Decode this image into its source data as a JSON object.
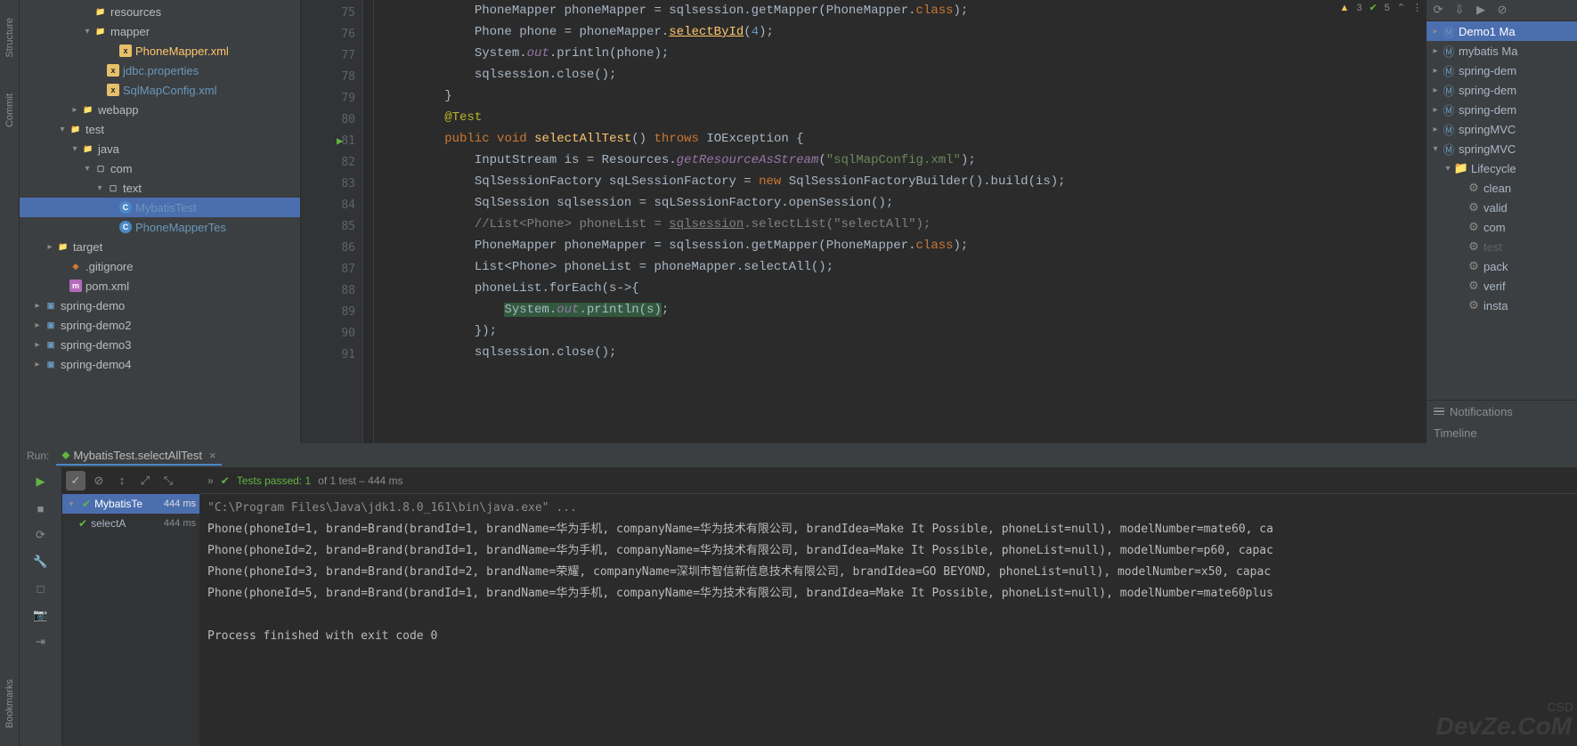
{
  "rail": {
    "structure": "Structure",
    "commit": "Commit",
    "bookmarks": "Bookmarks"
  },
  "tree": {
    "items": [
      {
        "indent": 5,
        "chev": "",
        "icon": "dir",
        "label": "resources",
        "cls": ""
      },
      {
        "indent": 5,
        "chev": "▾",
        "icon": "dir",
        "label": "mapper",
        "cls": ""
      },
      {
        "indent": 7,
        "chev": "",
        "icon": "xml",
        "label": "PhoneMapper.xml",
        "cls": "active-file"
      },
      {
        "indent": 6,
        "chev": "",
        "icon": "xml",
        "label": "jdbc.properties",
        "cls": "xml-link"
      },
      {
        "indent": 6,
        "chev": "",
        "icon": "xml",
        "label": "SqlMapConfig.xml",
        "cls": "xml-link"
      },
      {
        "indent": 4,
        "chev": "▸",
        "icon": "dir",
        "label": "webapp",
        "cls": ""
      },
      {
        "indent": 3,
        "chev": "▾",
        "icon": "test-dir",
        "label": "test",
        "cls": ""
      },
      {
        "indent": 4,
        "chev": "▾",
        "icon": "test-src",
        "label": "java",
        "cls": ""
      },
      {
        "indent": 5,
        "chev": "▾",
        "icon": "pkg",
        "label": "com",
        "cls": ""
      },
      {
        "indent": 6,
        "chev": "▾",
        "icon": "pkg",
        "label": "text",
        "cls": ""
      },
      {
        "indent": 7,
        "chev": "",
        "icon": "class",
        "label": "MybatisTest",
        "cls": "xml-link",
        "sel": true
      },
      {
        "indent": 7,
        "chev": "",
        "icon": "class",
        "label": "PhoneMapperTes",
        "cls": "xml-link"
      },
      {
        "indent": 2,
        "chev": "▸",
        "icon": "target",
        "label": "target",
        "cls": ""
      },
      {
        "indent": 3,
        "chev": "",
        "icon": "git",
        "label": ".gitignore",
        "cls": ""
      },
      {
        "indent": 3,
        "chev": "",
        "icon": "pom",
        "label": "pom.xml",
        "cls": ""
      },
      {
        "indent": 1,
        "chev": "▸",
        "icon": "mod",
        "label": "spring-demo",
        "cls": ""
      },
      {
        "indent": 1,
        "chev": "▸",
        "icon": "mod",
        "label": "spring-demo2",
        "cls": ""
      },
      {
        "indent": 1,
        "chev": "▸",
        "icon": "mod",
        "label": "spring-demo3",
        "cls": ""
      },
      {
        "indent": 1,
        "chev": "▸",
        "icon": "mod",
        "label": "spring-demo4",
        "cls": ""
      }
    ]
  },
  "editor": {
    "status_warn": "3",
    "status_ok": "5",
    "lines": [
      {
        "n": 75,
        "html": "            <span class='cls'>PhoneMapper phoneMapper = sqlsession.getMapper(PhoneMapper.</span><span class='kw'>class</span><span class='cls'>);</span>"
      },
      {
        "n": 76,
        "html": "            <span class='cls'>Phone phone = phoneMapper.</span><span class='mth und'>selectById</span><span class='cls'>(</span><span class='num'>4</span><span class='cls'>);</span>"
      },
      {
        "n": 77,
        "html": "            <span class='cls'>System.</span><span class='fld'>out</span><span class='cls'>.println(phone);</span>"
      },
      {
        "n": 78,
        "html": "            <span class='cls'>sqlsession.close();</span>"
      },
      {
        "n": 79,
        "html": "        <span class='cls'>}</span>"
      },
      {
        "n": 80,
        "html": "        <span class='ann'>@Test</span>"
      },
      {
        "n": 81,
        "html": "        <span class='kw'>public</span> <span class='kw'>void</span> <span class='mth'>selectAllTest</span><span class='cls'>()</span> <span class='kw'>throws</span> <span class='cls'>IOException {</span>",
        "run": true
      },
      {
        "n": 82,
        "html": "            <span class='cls'>InputStream is = Resources.</span><span class='fld'>getResourceAsStream</span><span class='cls'>(</span><span class='str'>\"sqlMapConfig.xml\"</span><span class='cls'>);</span>"
      },
      {
        "n": 83,
        "html": "            <span class='cls'>SqlSessionFactory sqLSessionFactory = </span><span class='kw'>new</span> <span class='cls'>SqlSessionFactoryBuilder().build(is);</span>"
      },
      {
        "n": 84,
        "html": "            <span class='cls'>SqlSession sqlsession = sqLSessionFactory.openSession();</span>"
      },
      {
        "n": 85,
        "html": "            <span class='cmt'>//List&lt;Phone&gt; phoneList = </span><span class='cmt und'>sqlsession</span><span class='cmt'>.selectList(\"selectAll\");</span>"
      },
      {
        "n": 86,
        "html": "            <span class='cls'>PhoneMapper phoneMapper = sqlsession.getMapper(PhoneMapper.</span><span class='kw'>class</span><span class='cls'>);</span>"
      },
      {
        "n": 87,
        "html": "            <span class='cls'>List&lt;Phone&gt; phoneList = phoneMapper.selectAll();</span>"
      },
      {
        "n": 88,
        "html": "            <span class='cls'>phoneList.forEach(s-&gt;{</span>"
      },
      {
        "n": 89,
        "html": "                <span class='hl'><span class='cls'>System.</span><span class='fld'>out</span><span class='cls'>.println(s)</span></span><span class='cls'>;</span>"
      },
      {
        "n": 90,
        "html": "            <span class='cls'>});</span>"
      },
      {
        "n": 91,
        "html": "            <span class='cls'>sqlsession.close();</span>"
      }
    ]
  },
  "maven": {
    "items": [
      {
        "indent": 0,
        "chev": "▸",
        "icon": "mod",
        "label": "Demo1 Ma",
        "sel": true
      },
      {
        "indent": 0,
        "chev": "▸",
        "icon": "mod",
        "label": "mybatis Ma"
      },
      {
        "indent": 0,
        "chev": "▸",
        "icon": "mod",
        "label": "spring-dem"
      },
      {
        "indent": 0,
        "chev": "▸",
        "icon": "mod",
        "label": "spring-dem"
      },
      {
        "indent": 0,
        "chev": "▸",
        "icon": "mod",
        "label": "spring-dem"
      },
      {
        "indent": 0,
        "chev": "▸",
        "icon": "mod",
        "label": "springMVC"
      },
      {
        "indent": 0,
        "chev": "▾",
        "icon": "mod",
        "label": "springMVC"
      },
      {
        "indent": 1,
        "chev": "▾",
        "icon": "folder",
        "label": "Lifecycle"
      },
      {
        "indent": 2,
        "chev": "",
        "icon": "gear",
        "label": "clean"
      },
      {
        "indent": 2,
        "chev": "",
        "icon": "gear",
        "label": "valid"
      },
      {
        "indent": 2,
        "chev": "",
        "icon": "gear",
        "label": "com"
      },
      {
        "indent": 2,
        "chev": "",
        "icon": "gear",
        "label": "test ",
        "dim": true
      },
      {
        "indent": 2,
        "chev": "",
        "icon": "gear",
        "label": "pack"
      },
      {
        "indent": 2,
        "chev": "",
        "icon": "gear",
        "label": "verif"
      },
      {
        "indent": 2,
        "chev": "",
        "icon": "gear",
        "label": "insta"
      }
    ],
    "notifications": "Notifications",
    "timeline": "Timeline"
  },
  "run": {
    "label": "Run:",
    "tab": "MybatisTest.selectAllTest",
    "status": "Tests passed: 1",
    "status_suffix": " of 1 test – 444 ms",
    "tests": [
      {
        "name": "MybatisTe",
        "time": "444 ms",
        "root": true
      },
      {
        "name": "selectA",
        "time": "444 ms"
      }
    ],
    "console": [
      "\"C:\\Program Files\\Java\\jdk1.8.0_161\\bin\\java.exe\" ...",
      "Phone(phoneId=1, brand=Brand(brandId=1, brandName=华为手机, companyName=华为技术有限公司, brandIdea=Make It Possible, phoneList=null), modelNumber=mate60, ca",
      "Phone(phoneId=2, brand=Brand(brandId=1, brandName=华为手机, companyName=华为技术有限公司, brandIdea=Make It Possible, phoneList=null), modelNumber=p60, capac",
      "Phone(phoneId=3, brand=Brand(brandId=2, brandName=荣耀, companyName=深圳市智信新信息技术有限公司, brandIdea=GO BEYOND, phoneList=null), modelNumber=x50, capac",
      "Phone(phoneId=5, brand=Brand(brandId=1, brandName=华为手机, companyName=华为技术有限公司, brandIdea=Make It Possible, phoneList=null), modelNumber=mate60plus",
      "",
      "Process finished with exit code 0"
    ]
  },
  "watermark": "DevZe.CoM",
  "csd": "CSD"
}
